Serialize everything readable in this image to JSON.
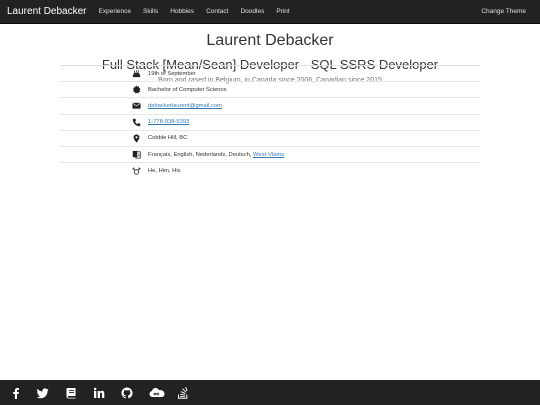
{
  "navbar": {
    "brand": "Laurent Debacker",
    "links": [
      "Experience",
      "Skills",
      "Hobbies",
      "Contact",
      "Doodles",
      "Print"
    ],
    "theme_button": "Change Theme"
  },
  "header": {
    "name": "Laurent Debacker",
    "title": "Full Stack [Mean/Sean] Developer - SQL SSRS Developer",
    "subtitle": "Born and rased in Belgium, in Canada since 2006, Canadian since 2015"
  },
  "info": {
    "birthday": "19th of September",
    "education": "Bachelor of Computer Science",
    "email": "debackerlaurent@gmail.com",
    "phone": "1-778-938-5393",
    "location": "Cobble Hill, BC",
    "languages_prefix": "Français, English, Nederlands, Deutsch, ",
    "languages_link": "West-Vlams",
    "pronouns": "He, Him, His"
  },
  "footer": {
    "icons": [
      "facebook-icon",
      "twitter-icon",
      "book-icon",
      "linkedin-icon",
      "github-icon",
      "cloud-infinity-icon",
      "stackoverflow-icon"
    ]
  },
  "colors": {
    "navbar_bg": "#222222",
    "link": "#337ab7",
    "text": "#333333",
    "muted": "#777777"
  }
}
